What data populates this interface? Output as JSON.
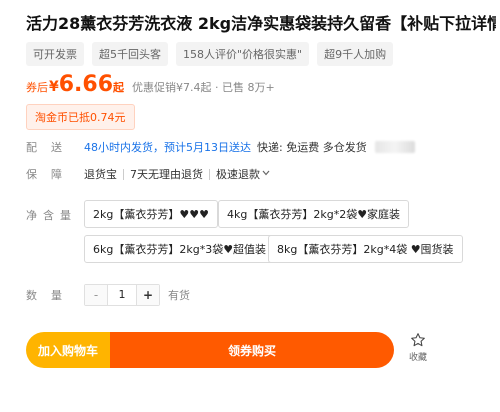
{
  "product": {
    "title": "活力28薰衣芬芳洗衣液 2kg洁净实惠袋装持久留香【补贴下拉详情】",
    "tags": [
      "可开发票",
      "超5千回头客",
      "158人评价\"价格很实惠\"",
      "超9千人加购"
    ]
  },
  "price": {
    "prefix": "券后",
    "currency": "¥",
    "value": "6.66",
    "suffix": "起",
    "note": "优惠促销¥7.4起 · 已售 8万+"
  },
  "coin": "淘金币已抵0.74元",
  "delivery": {
    "label": "配送",
    "time": "48小时内发货，预计5月13日送达",
    "text": "快递: 免运费  多仓发货"
  },
  "guarantee": {
    "label": "保障",
    "items": [
      "退货宝",
      "7天无理由退货",
      "极速退款"
    ]
  },
  "spec": {
    "label": "净含量",
    "options": [
      "2kg【薰衣芬芳】♥♥♥",
      "4kg【薰衣芬芳】2kg*2袋♥家庭装",
      "6kg【薰衣芬芳】2kg*3袋♥超值装",
      "8kg【薰衣芬芳】2kg*4袋 ♥囤货装"
    ]
  },
  "quantity": {
    "label": "数量",
    "minus": "-",
    "value": "1",
    "plus": "+",
    "stock": "有货"
  },
  "actions": {
    "cart": "加入购物车",
    "buy": "领券购买",
    "favorite": "收藏"
  },
  "colors": {
    "accent": "#ff5000",
    "cart": "#ffb400",
    "buy": "#ff5a00",
    "link": "#1a73e8"
  }
}
